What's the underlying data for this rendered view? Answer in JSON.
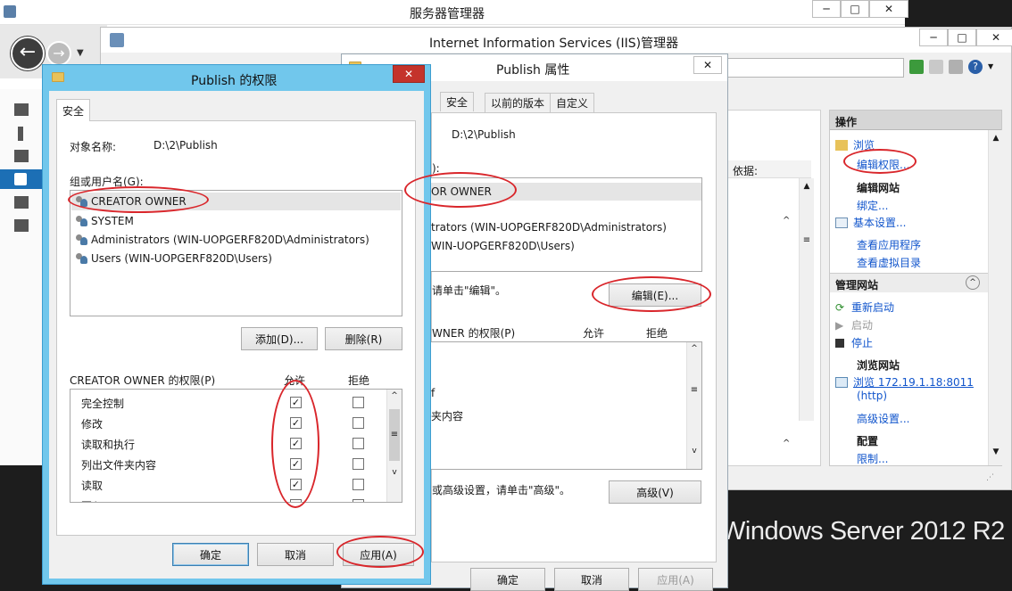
{
  "server_manager": {
    "title": "服务器管理器",
    "buttons": [
      "─",
      "□",
      "✕"
    ]
  },
  "iis": {
    "title": "Internet Information Services (IIS)管理器",
    "buttons": [
      "─",
      "□",
      "✕"
    ],
    "content_label": "依据:",
    "actions": {
      "header": "操作",
      "browse": "浏览",
      "edit_permissions": "编辑权限...",
      "edit_site_header": "编辑网站",
      "bindings": "绑定...",
      "basic_settings": "基本设置...",
      "view_apps": "查看应用程序",
      "view_vdirs": "查看虚拟目录",
      "manage_site_header": "管理网站",
      "restart": "重新启动",
      "start": "启动",
      "stop": "停止",
      "browse_site_header": "浏览网站",
      "browse_url_line1": "浏览 172.19.1.18:8011",
      "browse_url_line2": "(http)",
      "advanced_settings": "高级设置...",
      "config_header": "配置",
      "limits": "限制..."
    }
  },
  "props": {
    "title": "Publish 属性",
    "close": "✕",
    "tabs": [
      "安全",
      "以前的版本",
      "自定义"
    ],
    "object_path": "D:\\2\\Publish",
    "group_label_fragment": "):",
    "users": [
      "OR OWNER",
      "trators (WIN-UOPGERF820D\\Administrators)",
      "WIN-UOPGERF820D\\Users)"
    ],
    "edit_hint": "请单击\"编辑\"。",
    "edit_button": "编辑(E)...",
    "perm_label": "WNER 的权限(P)",
    "allow": "允许",
    "deny": "拒绝",
    "perm_fragments": [
      "",
      "",
      "f",
      "夹内容"
    ],
    "advanced_hint": "或高级设置，请单击\"高级\"。",
    "advanced_button": "高级(V)",
    "ok": "确定",
    "cancel": "取消",
    "apply": "应用(A)"
  },
  "perm": {
    "title": "Publish 的权限",
    "close": "✕",
    "tab": "安全",
    "object_label": "对象名称:",
    "object_path": "D:\\2\\Publish",
    "group_label": "组或用户名(G):",
    "users": [
      "CREATOR OWNER",
      "SYSTEM",
      "Administrators (WIN-UOPGERF820D\\Administrators)",
      "Users (WIN-UOPGERF820D\\Users)"
    ],
    "add_button": "添加(D)...",
    "remove_button": "删除(R)",
    "perm_label": "CREATOR OWNER 的权限(P)",
    "allow": "允许",
    "deny": "拒绝",
    "permissions": [
      {
        "name": "完全控制",
        "allow": true,
        "deny": false
      },
      {
        "name": "修改",
        "allow": true,
        "deny": false
      },
      {
        "name": "读取和执行",
        "allow": true,
        "deny": false
      },
      {
        "name": "列出文件夹内容",
        "allow": true,
        "deny": false
      },
      {
        "name": "读取",
        "allow": true,
        "deny": false
      },
      {
        "name": "写入",
        "allow": true,
        "deny": false
      }
    ],
    "ok": "确定",
    "cancel": "取消",
    "apply": "应用(A)"
  },
  "watermark": "Windows Server 2012 R2",
  "colors": {
    "dialog_frame": "#71c7ec",
    "close_red": "#c4332b",
    "annotation_red": "#d9262b",
    "link_blue": "#1155cc"
  }
}
